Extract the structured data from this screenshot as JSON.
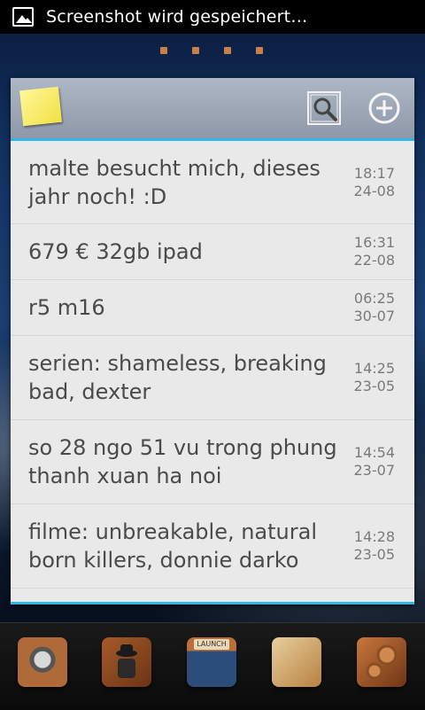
{
  "status_bar": {
    "notification_text": "Screenshot wird gespeichert…",
    "icon": "image-icon"
  },
  "home_screen": {
    "page_indicator_count": 4
  },
  "widget": {
    "icons": [
      "sticky-note-icon",
      "search-icon",
      "add-icon"
    ],
    "notes": [
      {
        "text": "malte besucht mich, dieses jahr noch!  :D",
        "time": "18:17",
        "date": "24-08"
      },
      {
        "text": "679 € 32gb ipad",
        "time": "16:31",
        "date": "22-08"
      },
      {
        "text": "r5 m16",
        "time": "06:25",
        "date": "30-07"
      },
      {
        "text": "serien: shameless, breaking bad, dexter",
        "time": "14:25",
        "date": "23-05"
      },
      {
        "text": "so 28 ngo 51 vu trong  phung thanh xuan ha noi",
        "time": "14:54",
        "date": "23-07"
      },
      {
        "text": "filme: unbreakable,  natural born killers, donnie darko",
        "time": "14:28",
        "date": "23-05"
      }
    ]
  },
  "dock": {
    "apps": [
      {
        "name": "phone-app-icon"
      },
      {
        "name": "contacts-app-icon"
      },
      {
        "name": "launcher-app-icon",
        "label": "LAUNCH"
      },
      {
        "name": "notes-app-icon"
      },
      {
        "name": "settings-app-icon"
      }
    ]
  },
  "colors": {
    "accent": "#33b5e5",
    "widget_bg": "#e9e9e9",
    "note_text": "#4a4a4a",
    "sticky_yellow": "#f2e044"
  }
}
